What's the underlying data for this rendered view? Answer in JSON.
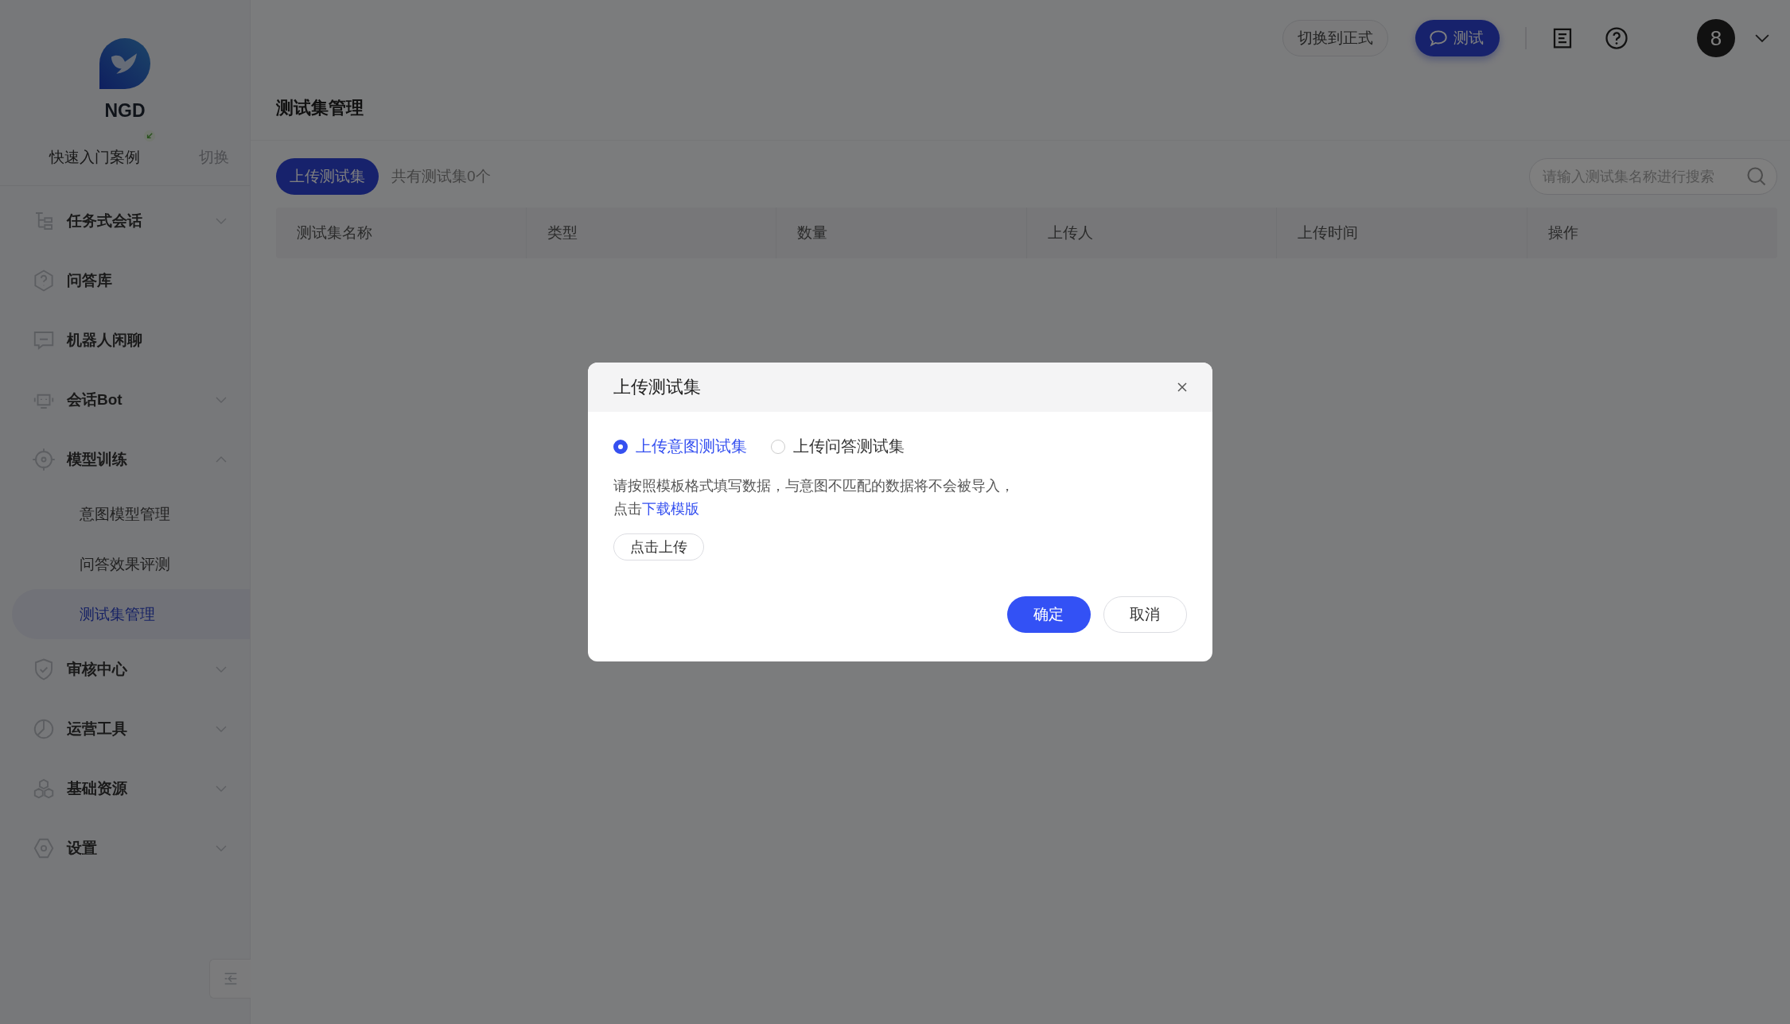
{
  "brand": {
    "name": "NGD"
  },
  "project": {
    "name": "快速入门案例",
    "switch": "切换"
  },
  "sidebar": {
    "items": [
      {
        "label": "任务式会话",
        "kind": "group",
        "expanded": false
      },
      {
        "label": "问答库",
        "kind": "link"
      },
      {
        "label": "机器人闲聊",
        "kind": "link"
      },
      {
        "label": "会话Bot",
        "kind": "group",
        "expanded": false
      },
      {
        "label": "模型训练",
        "kind": "group",
        "expanded": true,
        "children": [
          {
            "label": "意图模型管理",
            "selected": false
          },
          {
            "label": "问答效果评测",
            "selected": false
          },
          {
            "label": "测试集管理",
            "selected": true
          }
        ]
      },
      {
        "label": "审核中心",
        "kind": "group",
        "expanded": false
      },
      {
        "label": "运营工具",
        "kind": "group",
        "expanded": false
      },
      {
        "label": "基础资源",
        "kind": "group",
        "expanded": false
      },
      {
        "label": "设置",
        "kind": "group",
        "expanded": false
      }
    ]
  },
  "topbar": {
    "switch_env": "切换到正式",
    "test_button": "测试",
    "avatar": "8"
  },
  "page": {
    "title": "测试集管理",
    "upload_button": "上传测试集",
    "count": "共有测试集0个",
    "search": {
      "placeholder": "请输入测试集名称进行搜索"
    },
    "table": {
      "columns": [
        "测试集名称",
        "类型",
        "数量",
        "上传人",
        "上传时间",
        "操作"
      ]
    }
  },
  "dialog": {
    "title": "上传测试集",
    "options": [
      {
        "label": "上传意图测试集",
        "selected": true
      },
      {
        "label": "上传问答测试集",
        "selected": false
      }
    ],
    "note": "请按照模板格式填写数据，与意图不匹配的数据将不会被导入，",
    "note_action": "点击",
    "link": "下载模版",
    "upload": "点击上传",
    "ok": "确定",
    "cancel": "取消"
  }
}
